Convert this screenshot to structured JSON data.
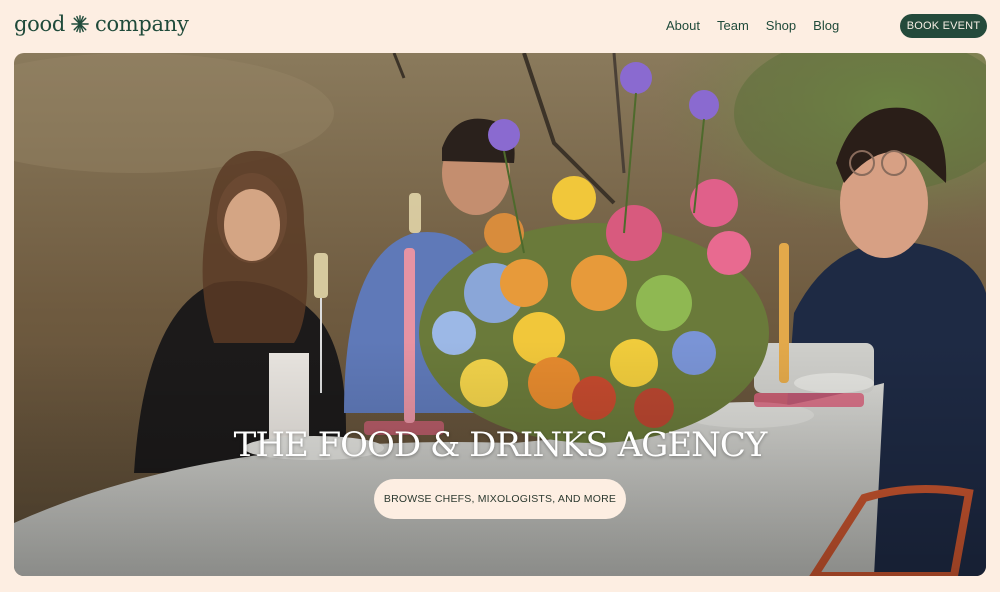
{
  "brand": {
    "name_left": "good",
    "name_right": "company",
    "logo_icon": "starburst-icon",
    "color": "#1f4a3a"
  },
  "nav": {
    "items": [
      {
        "label": "About"
      },
      {
        "label": "Team"
      },
      {
        "label": "Shop"
      },
      {
        "label": "Blog"
      }
    ]
  },
  "header": {
    "book_label": "BOOK EVENT"
  },
  "hero": {
    "title": "THE FOOD & DRINKS AGENCY",
    "cta_label": "BROWSE CHEFS, MIXOLOGISTS, AND MORE",
    "image_subject": "dinner-party-photo"
  },
  "colors": {
    "background": "#fdeee2",
    "accent": "#244a3b"
  }
}
